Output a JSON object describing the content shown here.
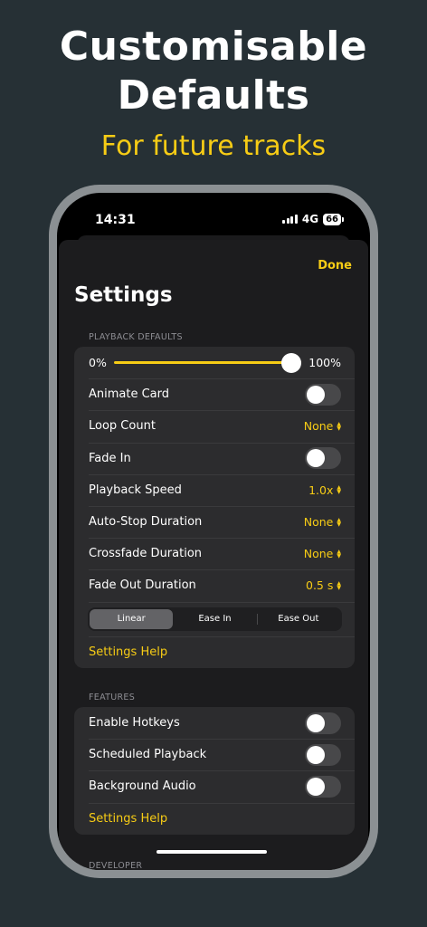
{
  "promo": {
    "headline_line1": "Customisable",
    "headline_line2": "Defaults",
    "subheadline": "For future tracks"
  },
  "status_bar": {
    "time": "14:31",
    "network": "4G",
    "battery": "66"
  },
  "nav": {
    "done_label": "Done",
    "title": "Settings"
  },
  "playback_defaults": {
    "section_label": "PLAYBACK DEFAULTS",
    "volume": {
      "min_label": "0%",
      "max_label": "100%",
      "value_percent": 100
    },
    "animate_card": {
      "label": "Animate Card",
      "on": false
    },
    "loop_count": {
      "label": "Loop Count",
      "value": "None"
    },
    "fade_in": {
      "label": "Fade In",
      "on": false
    },
    "playback_speed": {
      "label": "Playback Speed",
      "value": "1.0x"
    },
    "auto_stop": {
      "label": "Auto-Stop Duration",
      "value": "None"
    },
    "crossfade": {
      "label": "Crossfade Duration",
      "value": "None"
    },
    "fade_out": {
      "label": "Fade Out Duration",
      "value": "0.5 s"
    },
    "curve": {
      "options": [
        "Linear",
        "Ease In",
        "Ease Out"
      ],
      "selected": "Linear"
    },
    "help_label": "Settings Help"
  },
  "features": {
    "section_label": "FEATURES",
    "hotkeys": {
      "label": "Enable Hotkeys",
      "on": false
    },
    "scheduled": {
      "label": "Scheduled Playback",
      "on": false
    },
    "background_audio": {
      "label": "Background Audio",
      "on": false
    },
    "help_label": "Settings Help"
  },
  "developer": {
    "section_label": "DEVELOPER"
  },
  "colors": {
    "accent": "#F7CC15",
    "background": "#263035",
    "sheet": "#1C1C1E",
    "cell": "#2C2C2E"
  }
}
